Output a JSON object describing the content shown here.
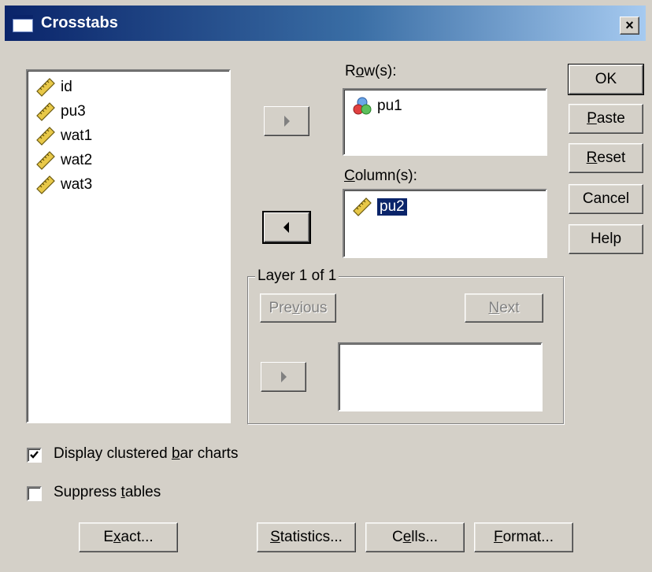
{
  "window": {
    "title": "Crosstabs",
    "close_symbol": "×"
  },
  "source_list": {
    "items": [
      "id",
      "pu3",
      "wat1",
      "wat2",
      "wat3"
    ]
  },
  "rows": {
    "label_pre": "R",
    "label_key": "o",
    "label_post": "w(s):",
    "items": [
      "pu1"
    ]
  },
  "columns": {
    "label_pre": "",
    "label_key": "C",
    "label_post": "olumn(s):",
    "items": [
      "pu2"
    ]
  },
  "layer": {
    "title": "Layer 1 of 1",
    "previous_pre": "Pre",
    "previous_key": "v",
    "previous_post": "ious",
    "next_pre": "",
    "next_key": "N",
    "next_post": "ext",
    "items": []
  },
  "side_buttons": {
    "ok": "OK",
    "paste_key": "P",
    "paste_post": "aste",
    "reset_key": "R",
    "reset_post": "eset",
    "cancel": "Cancel",
    "help": "Help"
  },
  "options": {
    "clustered_pre": "Display clustered ",
    "clustered_key": "b",
    "clustered_post": "ar charts",
    "clustered_checked": true,
    "suppress_pre": "Suppress ",
    "suppress_key": "t",
    "suppress_post": "ables",
    "suppress_checked": false
  },
  "bottom_buttons": {
    "exact_pre": "E",
    "exact_key": "x",
    "exact_post": "act...",
    "statistics_pre": "",
    "statistics_key": "S",
    "statistics_post": "tatistics...",
    "cells_pre": "C",
    "cells_key": "e",
    "cells_post": "lls...",
    "format_pre": "",
    "format_key": "F",
    "format_post": "ormat..."
  },
  "colors": {
    "title_start": "#0a246a",
    "title_end": "#a6caf0",
    "face": "#d4d0c8",
    "selection": "#0a246a"
  }
}
